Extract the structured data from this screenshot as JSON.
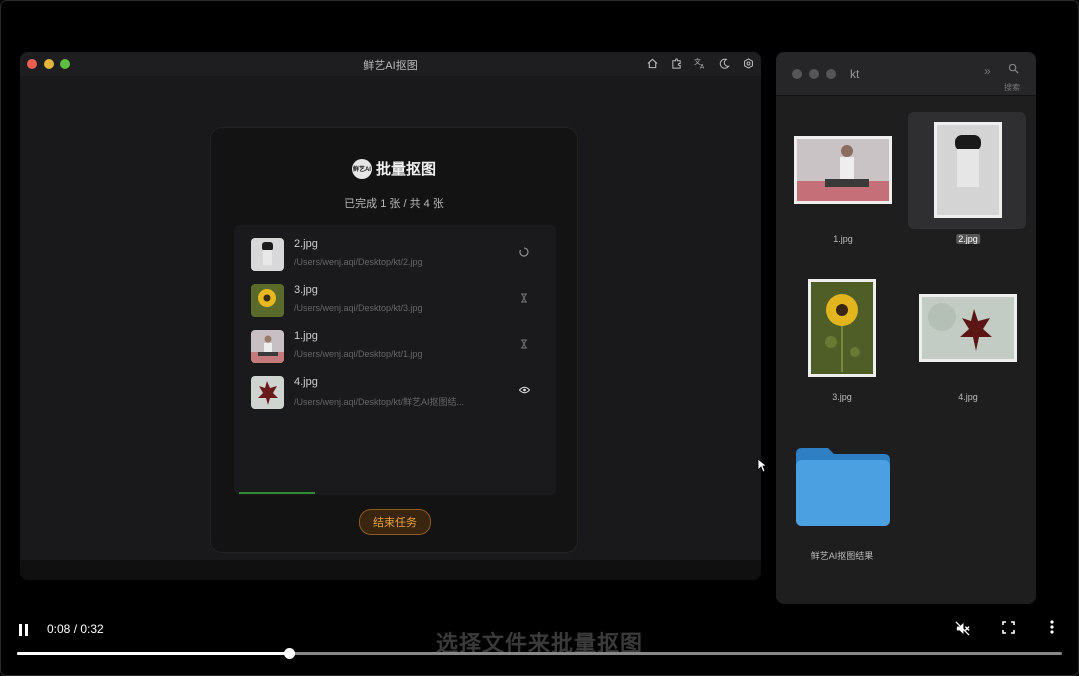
{
  "app": {
    "title": "鲜艺AI抠图",
    "toolbar_icons": [
      "home-icon",
      "puzzle-icon",
      "translate-icon",
      "moon-icon",
      "settings-icon"
    ]
  },
  "dialog": {
    "logo_text": "鲜艺AI",
    "title": "批量抠图",
    "subtitle": "已完成 1 张 / 共 4 张",
    "end_button": "结束任务",
    "progress": 0.25,
    "items": [
      {
        "name": "2.jpg",
        "path": "/Users/wenj.aqi/Desktop/kt/2.jpg",
        "status_icon": "loading-icon"
      },
      {
        "name": "3.jpg",
        "path": "/Users/wenj.aqi/Desktop/kt/3.jpg",
        "status_icon": "hourglass-icon"
      },
      {
        "name": "1.jpg",
        "path": "/Users/wenj.aqi/Desktop/kt/1.jpg",
        "status_icon": "hourglass-icon"
      },
      {
        "name": "4.jpg",
        "path": "/Users/wenj.aqi/Desktop/kt/鲜艺AI抠图结...",
        "status_icon": "eye-icon"
      }
    ]
  },
  "finder": {
    "title": "kt",
    "search_label": "搜索",
    "files": [
      {
        "name": "1.jpg",
        "selected": false
      },
      {
        "name": "2.jpg",
        "selected": true
      },
      {
        "name": "3.jpg",
        "selected": false
      },
      {
        "name": "4.jpg",
        "selected": false
      }
    ],
    "folder": {
      "name": "鲜艺AI抠图结果"
    }
  },
  "video": {
    "time": "0:08 / 0:32",
    "subtitle": "选择文件来批量抠图",
    "progress": 0.26
  },
  "colors": {
    "accent_orange": "#e8a040",
    "progress_green": "#2f8a2f",
    "folder_blue": "#3f93d6"
  }
}
